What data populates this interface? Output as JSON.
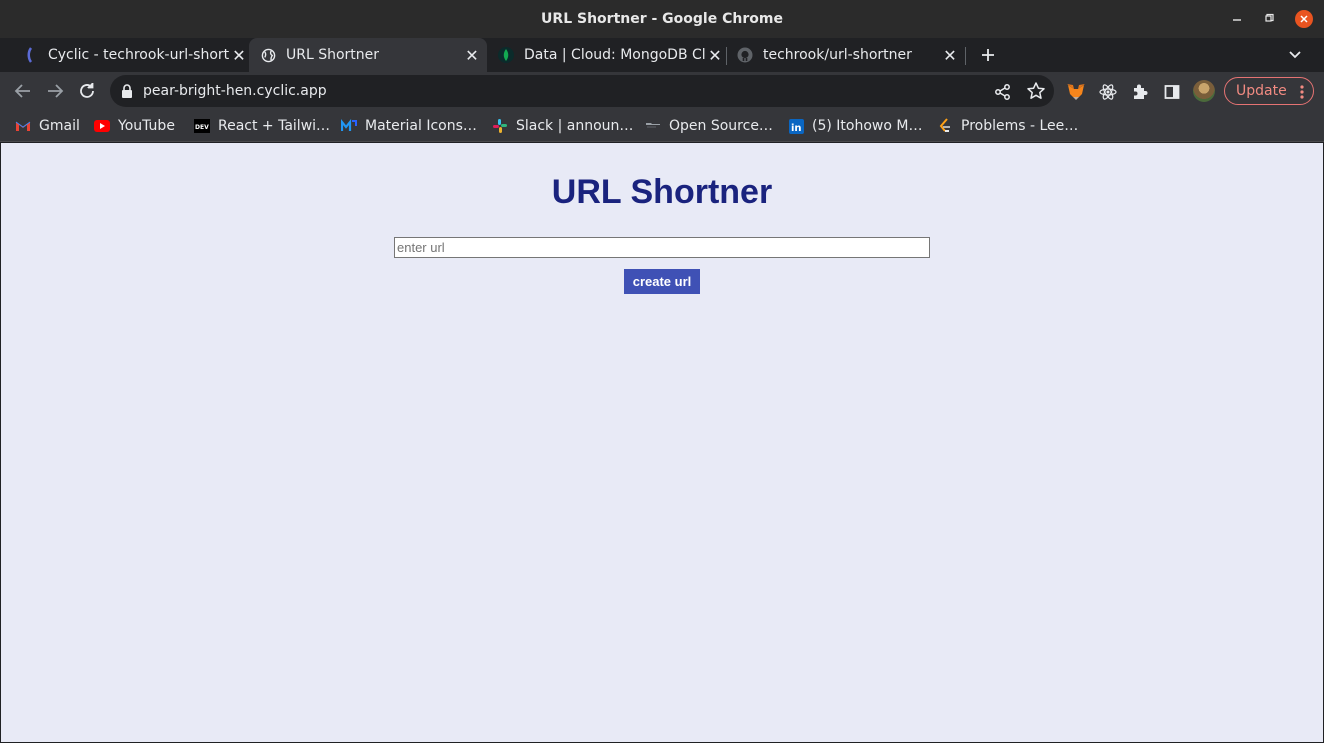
{
  "window": {
    "title": "URL Shortner - Google Chrome"
  },
  "tabs": [
    {
      "label": "Cyclic - techrook-url-short",
      "active": false
    },
    {
      "label": "URL Shortner",
      "active": true
    },
    {
      "label": "Data | Cloud: MongoDB Cl",
      "active": false
    },
    {
      "label": "techrook/url-shortner",
      "active": false
    }
  ],
  "toolbar": {
    "url": "pear-bright-hen.cyclic.app",
    "update_label": "Update"
  },
  "bookmarks": [
    {
      "label": "Gmail",
      "icon": "gmail-icon"
    },
    {
      "label": "YouTube",
      "icon": "youtube-icon"
    },
    {
      "label": "React + Tailwi…",
      "icon": "dev-icon"
    },
    {
      "label": "Material Icons…",
      "icon": "material-icon"
    },
    {
      "label": "Slack | announ…",
      "icon": "slack-icon"
    },
    {
      "label": "Open Source…",
      "icon": "folder-icon"
    },
    {
      "label": "(5) Itohowo M…",
      "icon": "linkedin-icon"
    },
    {
      "label": "Problems - Lee…",
      "icon": "leetcode-icon"
    }
  ],
  "page": {
    "title": "URL Shortner",
    "input_placeholder": "enter url",
    "input_value": "",
    "button_label": "create url"
  },
  "colors": {
    "page_background": "#e8eaf6",
    "title_color": "#1a237e",
    "button_background": "#3f51b5",
    "update_accent": "#f28b82"
  }
}
